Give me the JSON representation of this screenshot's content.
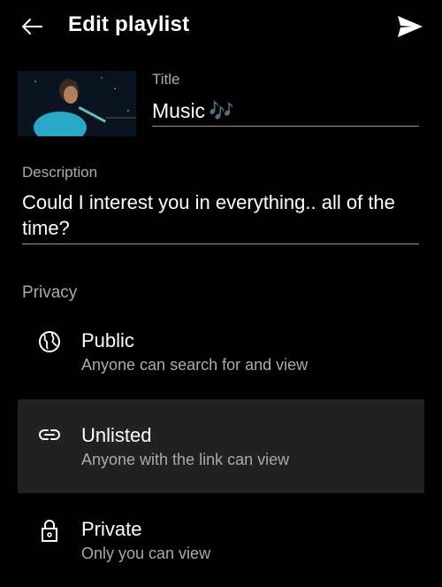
{
  "header": {
    "title": "Edit playlist"
  },
  "title_field": {
    "label": "Title",
    "value": "Music",
    "emoji": "🎶"
  },
  "description_field": {
    "label": "Description",
    "value": "Could I interest you in everything.. all of the time?"
  },
  "privacy": {
    "label": "Privacy",
    "options": [
      {
        "name": "Public",
        "description": "Anyone can search for and view",
        "icon": "globe-icon",
        "selected": false
      },
      {
        "name": "Unlisted",
        "description": "Anyone with the link can view",
        "icon": "link-icon",
        "selected": true
      },
      {
        "name": "Private",
        "description": "Only you can view",
        "icon": "lock-icon",
        "selected": false
      }
    ]
  },
  "colors": {
    "background": "#000000",
    "selected_row": "#212121",
    "secondary_text": "#aaaaaa",
    "accent": "#4fa3ff"
  }
}
